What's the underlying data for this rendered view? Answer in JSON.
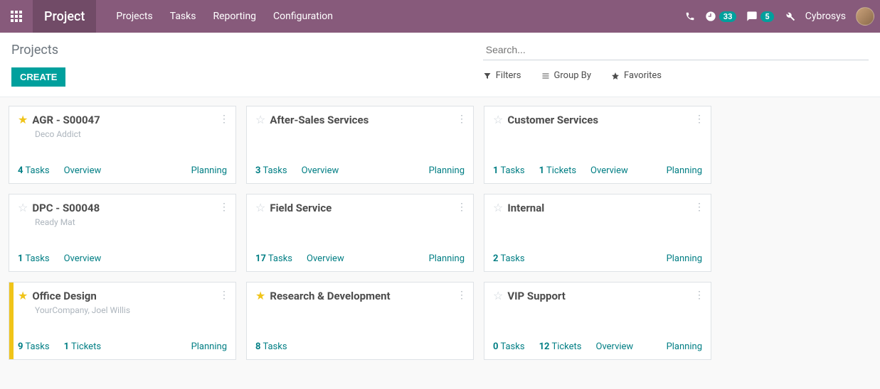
{
  "topbar": {
    "brand": "Project",
    "menu": [
      "Projects",
      "Tasks",
      "Reporting",
      "Configuration"
    ],
    "clock_badge": "33",
    "chat_badge": "5",
    "username": "Cybrosys"
  },
  "breadcrumb": "Projects",
  "create_label": "CREATE",
  "search": {
    "placeholder": "Search..."
  },
  "filters_label": "Filters",
  "groupby_label": "Group By",
  "favorites_label": "Favorites",
  "link_labels": {
    "tasks": "Tasks",
    "tickets": "Tickets",
    "overview": "Overview",
    "planning": "Planning"
  },
  "cards": [
    {
      "favorited": true,
      "highlight": false,
      "title": "AGR - S00047",
      "subtitle": "Deco Addict",
      "tasks": 4,
      "tickets": null,
      "overview": true,
      "planning": true
    },
    {
      "favorited": false,
      "highlight": false,
      "title": "After-Sales Services",
      "subtitle": "",
      "tasks": 3,
      "tickets": null,
      "overview": true,
      "planning": true
    },
    {
      "favorited": false,
      "highlight": false,
      "title": "Customer Services",
      "subtitle": "",
      "tasks": 1,
      "tickets": 1,
      "overview": true,
      "planning": true
    },
    {
      "favorited": false,
      "highlight": false,
      "title": "DPC - S00048",
      "subtitle": "Ready Mat",
      "tasks": 1,
      "tickets": null,
      "overview": true,
      "planning": false
    },
    {
      "favorited": false,
      "highlight": false,
      "title": "Field Service",
      "subtitle": "",
      "tasks": 17,
      "tickets": null,
      "overview": true,
      "planning": true
    },
    {
      "favorited": false,
      "highlight": false,
      "title": "Internal",
      "subtitle": "",
      "tasks": 2,
      "tickets": null,
      "overview": false,
      "planning": true
    },
    {
      "favorited": true,
      "highlight": true,
      "title": "Office Design",
      "subtitle": "YourCompany, Joel Willis",
      "tasks": 9,
      "tickets": 1,
      "overview": false,
      "planning": true
    },
    {
      "favorited": true,
      "highlight": false,
      "title": "Research & Development",
      "subtitle": "",
      "tasks": 8,
      "tickets": null,
      "overview": false,
      "planning": false
    },
    {
      "favorited": false,
      "highlight": false,
      "title": "VIP Support",
      "subtitle": "",
      "tasks": 0,
      "tickets": 12,
      "overview": true,
      "planning": true
    }
  ]
}
